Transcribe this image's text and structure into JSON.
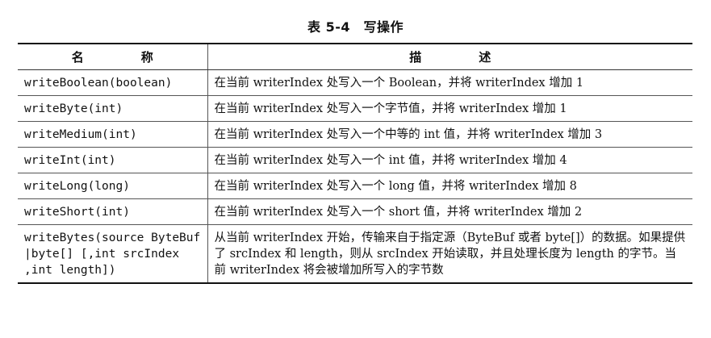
{
  "caption": "表 5-4　写操作",
  "table": {
    "headers": [
      "名　称",
      "描　述"
    ],
    "rows": [
      {
        "name": "writeBoolean(boolean)",
        "desc": "在当前 writerIndex 处写入一个 Boolean，并将 writerIndex 增加 1"
      },
      {
        "name": "writeByte(int)",
        "desc": "在当前 writerIndex 处写入一个字节值，并将 writerIndex 增加 1"
      },
      {
        "name": "writeMedium(int)",
        "desc": "在当前 writerIndex 处写入一个中等的 int 值，并将 writerIndex 增加 3"
      },
      {
        "name": "writeInt(int)",
        "desc": "在当前 writerIndex 处写入一个 int 值，并将 writerIndex 增加 4"
      },
      {
        "name": "writeLong(long)",
        "desc": "在当前 writerIndex 处写入一个 long 值，并将 writerIndex 增加 8"
      },
      {
        "name": "writeShort(int)",
        "desc": "在当前 writerIndex 处写入一个 short 值，并将 writerIndex 增加 2"
      },
      {
        "name": "writeBytes(source ByteBuf |byte[] [,int srcIndex ,int length])",
        "desc": "从当前 writerIndex 开始，传输来自于指定源（ByteBuf 或者 byte[]）的数据。如果提供了 srcIndex 和 length，则从 srcIndex 开始读取，并且处理长度为 length 的字节。当前 writerIndex 将会被增加所写入的字节数"
      }
    ]
  }
}
